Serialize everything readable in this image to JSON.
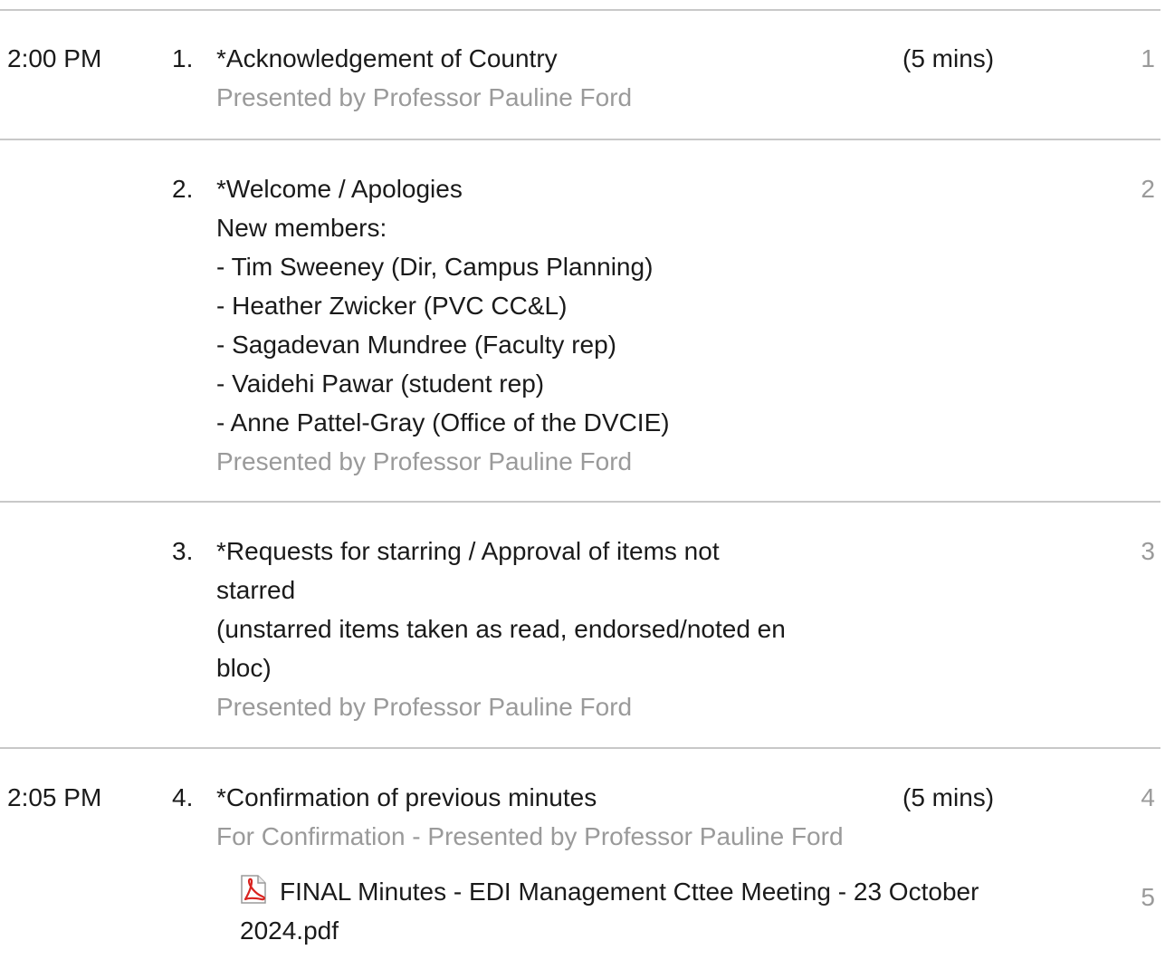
{
  "items": [
    {
      "time": "2:00 PM",
      "number": "1.",
      "title": "*Acknowledgement of Country",
      "duration": "(5 mins)",
      "presenter": "Presented by Professor Pauline Ford",
      "page": "1"
    },
    {
      "time": "",
      "number": "2.",
      "title": "*Welcome / Apologies",
      "body_lines": [
        "New members:",
        "- Tim Sweeney (Dir, Campus Planning)",
        "- Heather Zwicker (PVC CC&L)",
        "- Sagadevan Mundree (Faculty rep)",
        "- Vaidehi Pawar (student rep)",
        "- Anne Pattel-Gray (Office of the DVCIE)"
      ],
      "presenter": "Presented by Professor Pauline Ford",
      "page": "2"
    },
    {
      "time": "",
      "number": "3.",
      "title_lines": [
        "*Requests for starring / Approval of items not",
        "starred",
        "(unstarred items taken as read, endorsed/noted en",
        "bloc)"
      ],
      "presenter": "Presented by Professor Pauline Ford",
      "page": "3"
    },
    {
      "time": "2:05 PM",
      "number": "4.",
      "title": "*Confirmation of previous minutes",
      "duration": "(5 mins)",
      "presenter": "For Confirmation - Presented by Professor Pauline Ford",
      "page": "4",
      "attachment": {
        "icon": "pdf-icon",
        "name": "FINAL Minutes - EDI Management Cttee Meeting - 23 October 2024.pdf",
        "page": "5"
      }
    }
  ],
  "colors": {
    "text": "#1a1a1a",
    "muted": "#9a9a9a",
    "divider": "#c8c8c8",
    "pdf_red": "#d9231f"
  }
}
